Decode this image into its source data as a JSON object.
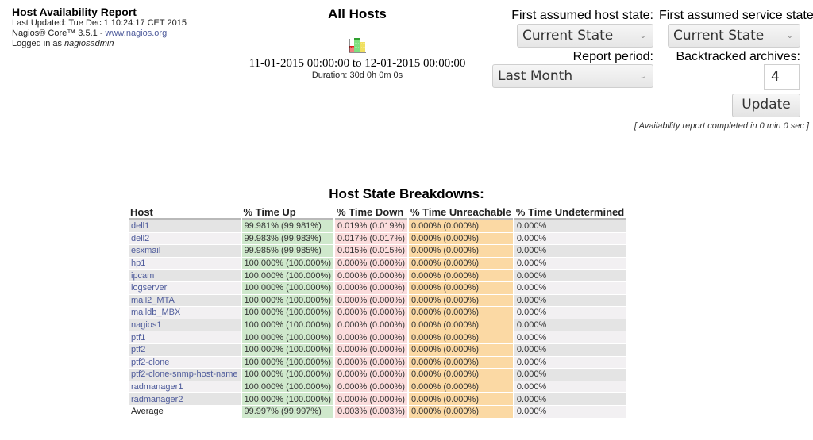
{
  "header": {
    "title": "Host Availability Report",
    "last_updated": "Last Updated: Tue Dec 1 10:24:17 CET 2015",
    "product_prefix": "Nagios® Core™ 3.5.1 - ",
    "product_link": "www.nagios.org",
    "logged_in_prefix": "Logged in as ",
    "logged_in_user": "nagiosadmin"
  },
  "report": {
    "title": "All Hosts",
    "chart_icon": "trends-chart-icon",
    "range": "11-01-2015 00:00:00 to 12-01-2015 00:00:00",
    "duration": "Duration: 30d 0h 0m 0s"
  },
  "options": {
    "host_state_label": "First assumed host state:",
    "host_state_value": "Current State",
    "service_state_label": "First assumed service state",
    "service_state_value": "Current State",
    "report_period_label": "Report period:",
    "report_period_value": "Last Month",
    "backtracked_label": "Backtracked archives:",
    "backtracked_value": "4",
    "update_label": "Update",
    "completed_text": "[ Availability report completed in 0 min 0 sec ]"
  },
  "breakdown": {
    "title": "Host State Breakdowns:",
    "columns": [
      "Host",
      "% Time Up",
      "% Time Down",
      "% Time Unreachable",
      "% Time Undetermined"
    ],
    "rows": [
      {
        "host": "dell1",
        "up": "99.981% (99.981%)",
        "down": "0.019% (0.019%)",
        "unreach": "0.000% (0.000%)",
        "undet": "0.000%"
      },
      {
        "host": "dell2",
        "up": "99.983% (99.983%)",
        "down": "0.017% (0.017%)",
        "unreach": "0.000% (0.000%)",
        "undet": "0.000%"
      },
      {
        "host": "esxmail",
        "up": "99.985% (99.985%)",
        "down": "0.015% (0.015%)",
        "unreach": "0.000% (0.000%)",
        "undet": "0.000%"
      },
      {
        "host": "hp1",
        "up": "100.000% (100.000%)",
        "down": "0.000% (0.000%)",
        "unreach": "0.000% (0.000%)",
        "undet": "0.000%"
      },
      {
        "host": "ipcam",
        "up": "100.000% (100.000%)",
        "down": "0.000% (0.000%)",
        "unreach": "0.000% (0.000%)",
        "undet": "0.000%"
      },
      {
        "host": "logserver",
        "up": "100.000% (100.000%)",
        "down": "0.000% (0.000%)",
        "unreach": "0.000% (0.000%)",
        "undet": "0.000%"
      },
      {
        "host": "mail2_MTA",
        "up": "100.000% (100.000%)",
        "down": "0.000% (0.000%)",
        "unreach": "0.000% (0.000%)",
        "undet": "0.000%"
      },
      {
        "host": "maildb_MBX",
        "up": "100.000% (100.000%)",
        "down": "0.000% (0.000%)",
        "unreach": "0.000% (0.000%)",
        "undet": "0.000%"
      },
      {
        "host": "nagios1",
        "up": "100.000% (100.000%)",
        "down": "0.000% (0.000%)",
        "unreach": "0.000% (0.000%)",
        "undet": "0.000%"
      },
      {
        "host": "ptf1",
        "up": "100.000% (100.000%)",
        "down": "0.000% (0.000%)",
        "unreach": "0.000% (0.000%)",
        "undet": "0.000%"
      },
      {
        "host": "ptf2",
        "up": "100.000% (100.000%)",
        "down": "0.000% (0.000%)",
        "unreach": "0.000% (0.000%)",
        "undet": "0.000%"
      },
      {
        "host": "ptf2-clone",
        "up": "100.000% (100.000%)",
        "down": "0.000% (0.000%)",
        "unreach": "0.000% (0.000%)",
        "undet": "0.000%"
      },
      {
        "host": "ptf2-clone-snmp-host-name",
        "up": "100.000% (100.000%)",
        "down": "0.000% (0.000%)",
        "unreach": "0.000% (0.000%)",
        "undet": "0.000%"
      },
      {
        "host": "radmanager1",
        "up": "100.000% (100.000%)",
        "down": "0.000% (0.000%)",
        "unreach": "0.000% (0.000%)",
        "undet": "0.000%"
      },
      {
        "host": "radmanager2",
        "up": "100.000% (100.000%)",
        "down": "0.000% (0.000%)",
        "unreach": "0.000% (0.000%)",
        "undet": "0.000%"
      }
    ],
    "average": {
      "host": "Average",
      "up": "99.997% (99.997%)",
      "down": "0.003% (0.003%)",
      "unreach": "0.000% (0.000%)",
      "undet": "0.000%"
    }
  },
  "colors": {
    "up": "#cfe8cc",
    "down": "#fbdcdc",
    "unreachable": "#fbd9a4",
    "link": "#4e5b9b"
  }
}
